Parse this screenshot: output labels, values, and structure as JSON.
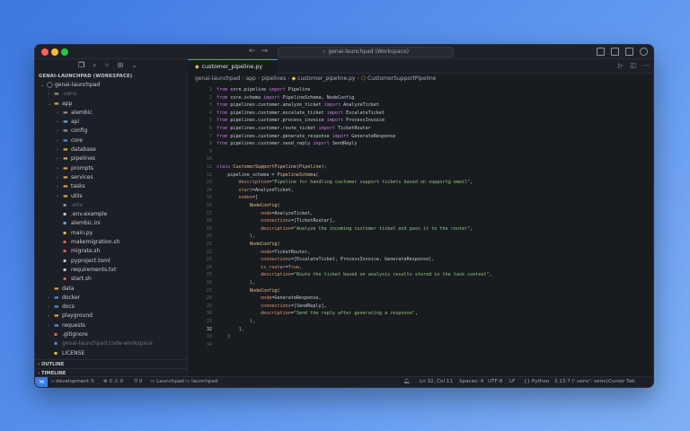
{
  "window": {
    "title": "genai-launchpad (Workspace)"
  },
  "sidebar": {
    "header": "GENAI-LAUNCHPAD (WORKSPACE)",
    "tree": [
      {
        "label": "genai-launchpad",
        "depth": 0,
        "kind": "root",
        "open": true
      },
      {
        "label": ".venv",
        "depth": 1,
        "kind": "folder",
        "open": false,
        "dim": true
      },
      {
        "label": "app",
        "depth": 1,
        "kind": "folder",
        "open": true
      },
      {
        "label": "alembic",
        "depth": 2,
        "kind": "folder",
        "open": false
      },
      {
        "label": "api",
        "depth": 2,
        "kind": "folder",
        "open": false
      },
      {
        "label": "config",
        "depth": 2,
        "kind": "folder",
        "open": false
      },
      {
        "label": "core",
        "depth": 2,
        "kind": "folder",
        "open": false
      },
      {
        "label": "database",
        "depth": 2,
        "kind": "folder",
        "open": false
      },
      {
        "label": "pipelines",
        "depth": 2,
        "kind": "folder",
        "open": false
      },
      {
        "label": "prompts",
        "depth": 2,
        "kind": "folder",
        "open": false
      },
      {
        "label": "services",
        "depth": 2,
        "kind": "folder",
        "open": false
      },
      {
        "label": "tasks",
        "depth": 2,
        "kind": "folder",
        "open": false
      },
      {
        "label": "utils",
        "depth": 2,
        "kind": "folder",
        "open": false
      },
      {
        "label": ".env",
        "depth": 2,
        "kind": "file",
        "dim": true
      },
      {
        "label": ".env.example",
        "depth": 2,
        "kind": "file"
      },
      {
        "label": "alembic.ini",
        "depth": 2,
        "kind": "file"
      },
      {
        "label": "main.py",
        "depth": 2,
        "kind": "file"
      },
      {
        "label": "makemigration.sh",
        "depth": 2,
        "kind": "file"
      },
      {
        "label": "migrate.sh",
        "depth": 2,
        "kind": "file"
      },
      {
        "label": "pyproject.toml",
        "depth": 2,
        "kind": "file"
      },
      {
        "label": "requirements.txt",
        "depth": 2,
        "kind": "file"
      },
      {
        "label": "start.sh",
        "depth": 2,
        "kind": "file"
      },
      {
        "label": "data",
        "depth": 1,
        "kind": "folder",
        "open": false,
        "nochev": true
      },
      {
        "label": "docker",
        "depth": 1,
        "kind": "folder",
        "open": false
      },
      {
        "label": "docs",
        "depth": 1,
        "kind": "folder",
        "open": false
      },
      {
        "label": "playground",
        "depth": 1,
        "kind": "folder",
        "open": false
      },
      {
        "label": "requests",
        "depth": 1,
        "kind": "folder",
        "open": false
      },
      {
        "label": ".gitignore",
        "depth": 1,
        "kind": "file"
      },
      {
        "label": "genai-launchpad.code-workspace",
        "depth": 1,
        "kind": "file",
        "dim": true
      },
      {
        "label": "LICENSE",
        "depth": 1,
        "kind": "file"
      }
    ],
    "outline_label": "OUTLINE",
    "timeline_label": "TIMELINE"
  },
  "tab": {
    "label": "customer_pipeline.py"
  },
  "breadcrumb": [
    "genai-launchpad",
    "app",
    "pipelines",
    "customer_pipeline.py",
    "CustomerSupportPipeline"
  ],
  "code": {
    "current_line": 32,
    "lines": [
      [
        [
          "kw",
          "from"
        ],
        [
          "t",
          " core.pipeline "
        ],
        [
          "kw",
          "import"
        ],
        [
          "t",
          " Pipeline"
        ]
      ],
      [
        [
          "kw",
          "from"
        ],
        [
          "t",
          " core.schema "
        ],
        [
          "kw",
          "import"
        ],
        [
          "t",
          " PipelineSchema, NodeConfig"
        ]
      ],
      [
        [
          "kw",
          "from"
        ],
        [
          "t",
          " pipelines.customer.analyze_ticket "
        ],
        [
          "kw",
          "import"
        ],
        [
          "t",
          " AnalyzeTicket"
        ]
      ],
      [
        [
          "kw",
          "from"
        ],
        [
          "t",
          " pipelines.customer.escalate_ticket "
        ],
        [
          "kw",
          "import"
        ],
        [
          "t",
          " EscalateTicket"
        ]
      ],
      [
        [
          "kw",
          "from"
        ],
        [
          "t",
          " pipelines.customer.process_invoice "
        ],
        [
          "kw",
          "import"
        ],
        [
          "t",
          " ProcessInvoice"
        ]
      ],
      [
        [
          "kw",
          "from"
        ],
        [
          "t",
          " pipelines.customer.route_ticket "
        ],
        [
          "kw",
          "import"
        ],
        [
          "t",
          " TicketRouter"
        ]
      ],
      [
        [
          "kw",
          "from"
        ],
        [
          "t",
          " pipelines.customer.generate_response "
        ],
        [
          "kw",
          "import"
        ],
        [
          "t",
          " GenerateResponse"
        ]
      ],
      [
        [
          "kw",
          "from"
        ],
        [
          "t",
          " pipelines.customer.send_reply "
        ],
        [
          "kw",
          "import"
        ],
        [
          "t",
          " SendReply"
        ]
      ],
      [],
      [],
      [
        [
          "kw",
          "class"
        ],
        [
          "t",
          " "
        ],
        [
          "cls",
          "CustomerSupportPipeline"
        ],
        [
          "t",
          "("
        ],
        [
          "cls",
          "Pipeline"
        ],
        [
          "t",
          "):"
        ]
      ],
      [
        [
          "t",
          "    pipeline_schema = "
        ],
        [
          "cls",
          "PipelineSchema"
        ],
        [
          "t",
          "("
        ]
      ],
      [
        [
          "t",
          "        "
        ],
        [
          "param",
          "description"
        ],
        [
          "t",
          "="
        ],
        [
          "str",
          "\"Pipeline for handling customer support tickets based on support@ email\""
        ],
        [
          "t",
          ","
        ]
      ],
      [
        [
          "t",
          "        "
        ],
        [
          "param",
          "start"
        ],
        [
          "t",
          "=AnalyzeTicket,"
        ]
      ],
      [
        [
          "t",
          "        "
        ],
        [
          "param",
          "nodes"
        ],
        [
          "t",
          "=["
        ]
      ],
      [
        [
          "t",
          "            "
        ],
        [
          "cls",
          "NodeConfig"
        ],
        [
          "t",
          "("
        ]
      ],
      [
        [
          "t",
          "                "
        ],
        [
          "param",
          "node"
        ],
        [
          "t",
          "=AnalyzeTicket,"
        ]
      ],
      [
        [
          "t",
          "                "
        ],
        [
          "param",
          "connections"
        ],
        [
          "t",
          "=[TicketRouter],"
        ]
      ],
      [
        [
          "t",
          "                "
        ],
        [
          "param",
          "description"
        ],
        [
          "t",
          "="
        ],
        [
          "str",
          "\"Analyze the incoming customer ticket and pass it to the router\""
        ],
        [
          "t",
          ","
        ]
      ],
      [
        [
          "t",
          "            ),"
        ]
      ],
      [
        [
          "t",
          "            "
        ],
        [
          "cls",
          "NodeConfig"
        ],
        [
          "t",
          "("
        ]
      ],
      [
        [
          "t",
          "                "
        ],
        [
          "param",
          "node"
        ],
        [
          "t",
          "=TicketRouter,"
        ]
      ],
      [
        [
          "t",
          "                "
        ],
        [
          "param",
          "connections"
        ],
        [
          "t",
          "=[EscalateTicket, ProcessInvoice, GenerateResponse],"
        ]
      ],
      [
        [
          "t",
          "                "
        ],
        [
          "param",
          "is_router"
        ],
        [
          "t",
          "="
        ],
        [
          "bool",
          "True"
        ],
        [
          "t",
          ","
        ]
      ],
      [
        [
          "t",
          "                "
        ],
        [
          "param",
          "description"
        ],
        [
          "t",
          "="
        ],
        [
          "str",
          "\"Route the ticket based on analysis results stored in the task context\""
        ],
        [
          "t",
          ","
        ]
      ],
      [
        [
          "t",
          "            ),"
        ]
      ],
      [
        [
          "t",
          "            "
        ],
        [
          "cls",
          "NodeConfig"
        ],
        [
          "t",
          "("
        ]
      ],
      [
        [
          "t",
          "                "
        ],
        [
          "param",
          "node"
        ],
        [
          "t",
          "=GenerateResponse,"
        ]
      ],
      [
        [
          "t",
          "                "
        ],
        [
          "param",
          "connections"
        ],
        [
          "t",
          "=[SendReply],"
        ]
      ],
      [
        [
          "t",
          "                "
        ],
        [
          "param",
          "description"
        ],
        [
          "t",
          "="
        ],
        [
          "str",
          "\"Send the reply after generating a response\""
        ],
        [
          "t",
          ","
        ]
      ],
      [
        [
          "t",
          "            ),"
        ]
      ],
      [
        [
          "t",
          "        ],"
        ]
      ],
      [
        [
          "t",
          "    )"
        ]
      ],
      []
    ]
  },
  "statusbar": {
    "branch": "development",
    "errors": "0",
    "warnings": "0",
    "ports": "0",
    "workspace": "Launchpad",
    "launchpad": "launchpad",
    "cursor": "Ln 32, Col 11",
    "spaces": "Spaces: 4",
    "encoding": "UTF-8",
    "eol": "LF",
    "language": "Python",
    "interpreter": "3.13.7 ('.venv': venv)",
    "cursor_tab": "Cursor Tab"
  },
  "colors": {
    "accent": "#3b7ee0",
    "folder": "#d9a441",
    "python": "#e8c24d"
  }
}
